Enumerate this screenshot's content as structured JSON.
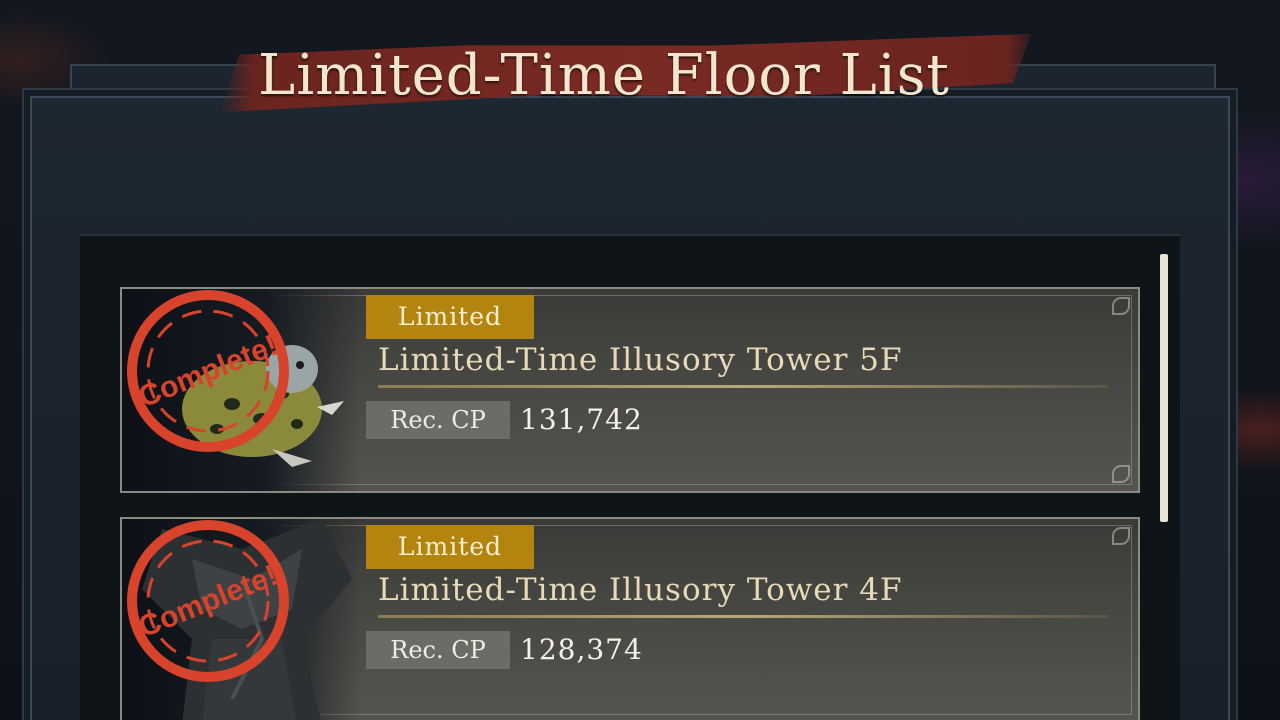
{
  "header": {
    "title": "Limited-Time Floor List"
  },
  "floors": [
    {
      "badge": "Limited",
      "name": "Limited-Time Illusory Tower 5F",
      "cp_label": "Rec. CP",
      "cp_value": "131,742",
      "status": "Complete!"
    },
    {
      "badge": "Limited",
      "name": "Limited-Time Illusory Tower 4F",
      "cp_label": "Rec. CP",
      "cp_value": "128,374",
      "status": "Complete!"
    }
  ],
  "colors": {
    "badge": "#b3850f",
    "title_banner": "#7b2a24",
    "stamp": "#d8432c",
    "floor_name": "#e8d9b7"
  },
  "icons": {
    "stamp": "complete-stamp-icon",
    "portrait": "boss-portrait-icon"
  }
}
